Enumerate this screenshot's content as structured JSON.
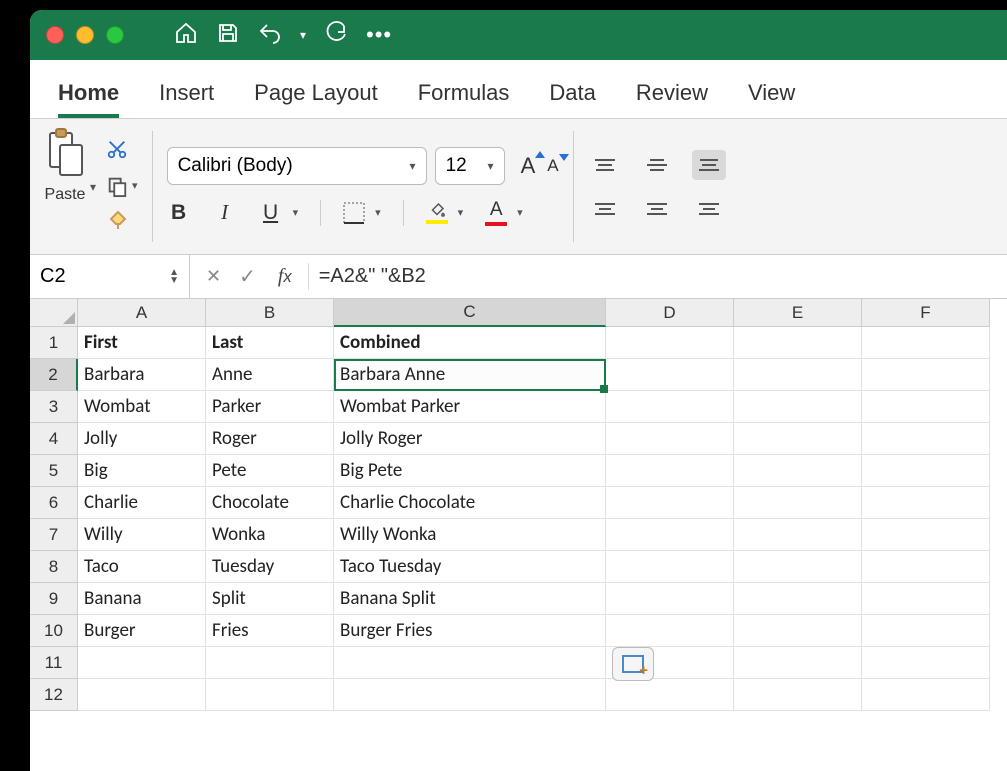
{
  "tabs": [
    "Home",
    "Insert",
    "Page Layout",
    "Formulas",
    "Data",
    "Review",
    "View"
  ],
  "activeTab": 0,
  "paste_label": "Paste",
  "font": {
    "name": "Calibri (Body)",
    "size": "12"
  },
  "namebox": "C2",
  "formula": "=A2&\" \"&B2",
  "columns": [
    "A",
    "B",
    "C",
    "D",
    "E",
    "F"
  ],
  "selectedCol": 2,
  "selectedRow": 2,
  "headers": {
    "A": "First",
    "B": "Last",
    "C": "Combined"
  },
  "rows": [
    {
      "n": 1,
      "A": "First",
      "B": "Last",
      "C": "Combined",
      "hdr": true
    },
    {
      "n": 2,
      "A": "Barbara",
      "B": "Anne",
      "C": "Barbara Anne"
    },
    {
      "n": 3,
      "A": "Wombat",
      "B": "Parker",
      "C": "Wombat Parker"
    },
    {
      "n": 4,
      "A": "Jolly",
      "B": "Roger",
      "C": "Jolly Roger"
    },
    {
      "n": 5,
      "A": "Big",
      "B": "Pete",
      "C": "Big Pete"
    },
    {
      "n": 6,
      "A": "Charlie",
      "B": "Chocolate",
      "C": "Charlie Chocolate"
    },
    {
      "n": 7,
      "A": "Willy",
      "B": "Wonka",
      "C": "Willy Wonka"
    },
    {
      "n": 8,
      "A": "Taco",
      "B": "Tuesday",
      "C": "Taco Tuesday"
    },
    {
      "n": 9,
      "A": "Banana",
      "B": "Split",
      "C": "Banana Split"
    },
    {
      "n": 10,
      "A": "Burger",
      "B": "Fries",
      "C": "Burger Fries"
    },
    {
      "n": 11,
      "A": "",
      "B": "",
      "C": ""
    },
    {
      "n": 12,
      "A": "",
      "B": "",
      "C": ""
    }
  ],
  "selection": {
    "col": "C",
    "row": 2
  },
  "colors": {
    "accent": "#1a7a4c",
    "highlight": "#ffeb00",
    "fontcolor": "#e81123"
  }
}
